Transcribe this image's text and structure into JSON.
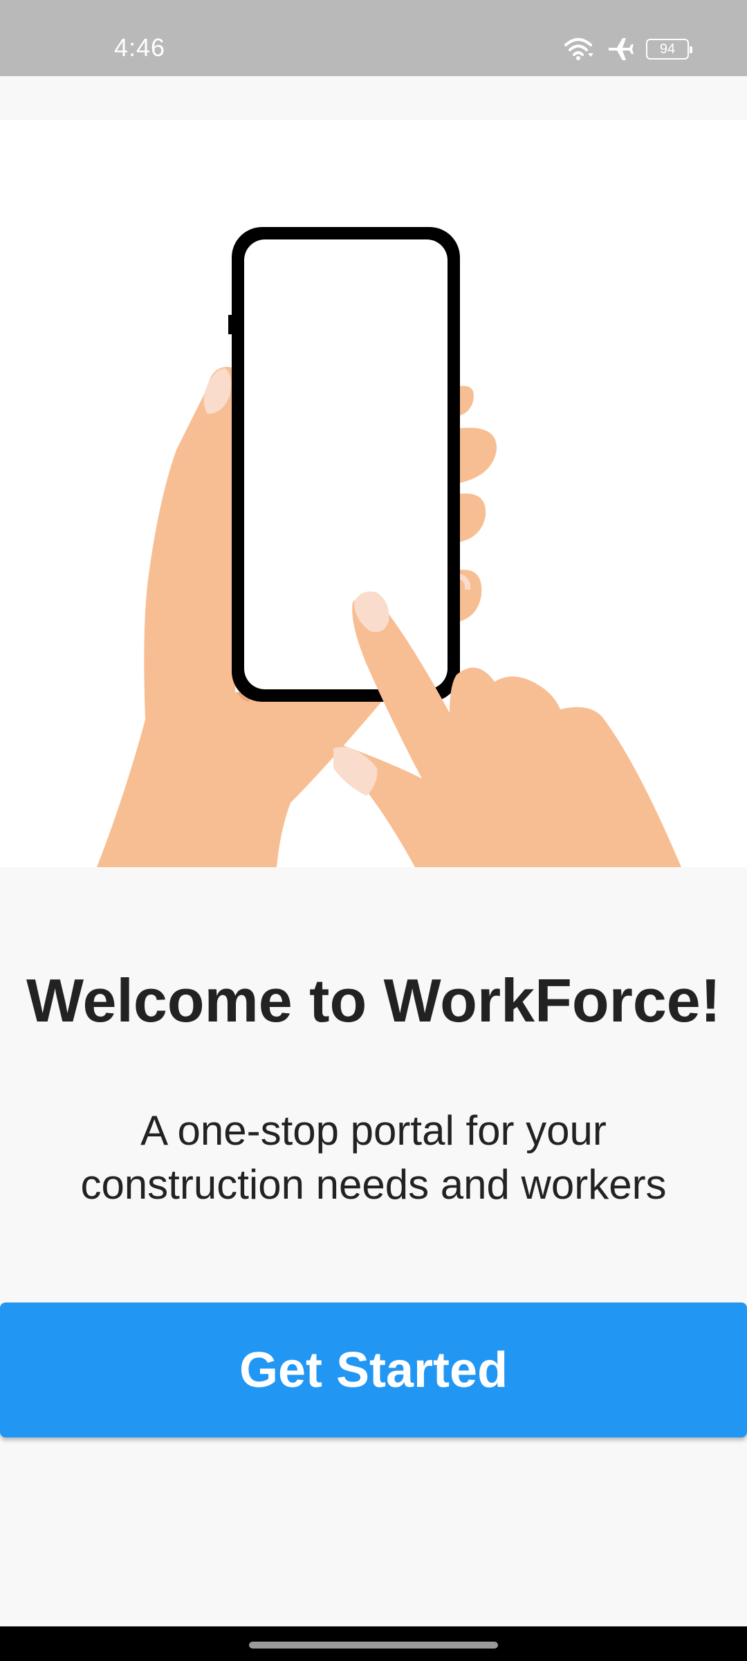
{
  "status_bar": {
    "time": "4:46",
    "battery_level": "94",
    "icons": [
      "wifi-icon",
      "airplane-mode-icon",
      "battery-icon"
    ]
  },
  "illustration": {
    "icon": "hand-holding-phone-illustration",
    "colors": {
      "skin": "#f8be93",
      "nail": "#f9dccb",
      "phone_frame": "#000000",
      "phone_screen": "#ffffff"
    }
  },
  "welcome": {
    "title": "Welcome to WorkForce!",
    "subtitle_line1": "A one-stop portal for your",
    "subtitle_line2": "construction needs and workers"
  },
  "actions": {
    "get_started_label": "Get Started"
  },
  "colors": {
    "primary": "#2196f3",
    "background": "#f8f8f8",
    "text": "#222222",
    "status_bar": "#b9b9b9"
  }
}
